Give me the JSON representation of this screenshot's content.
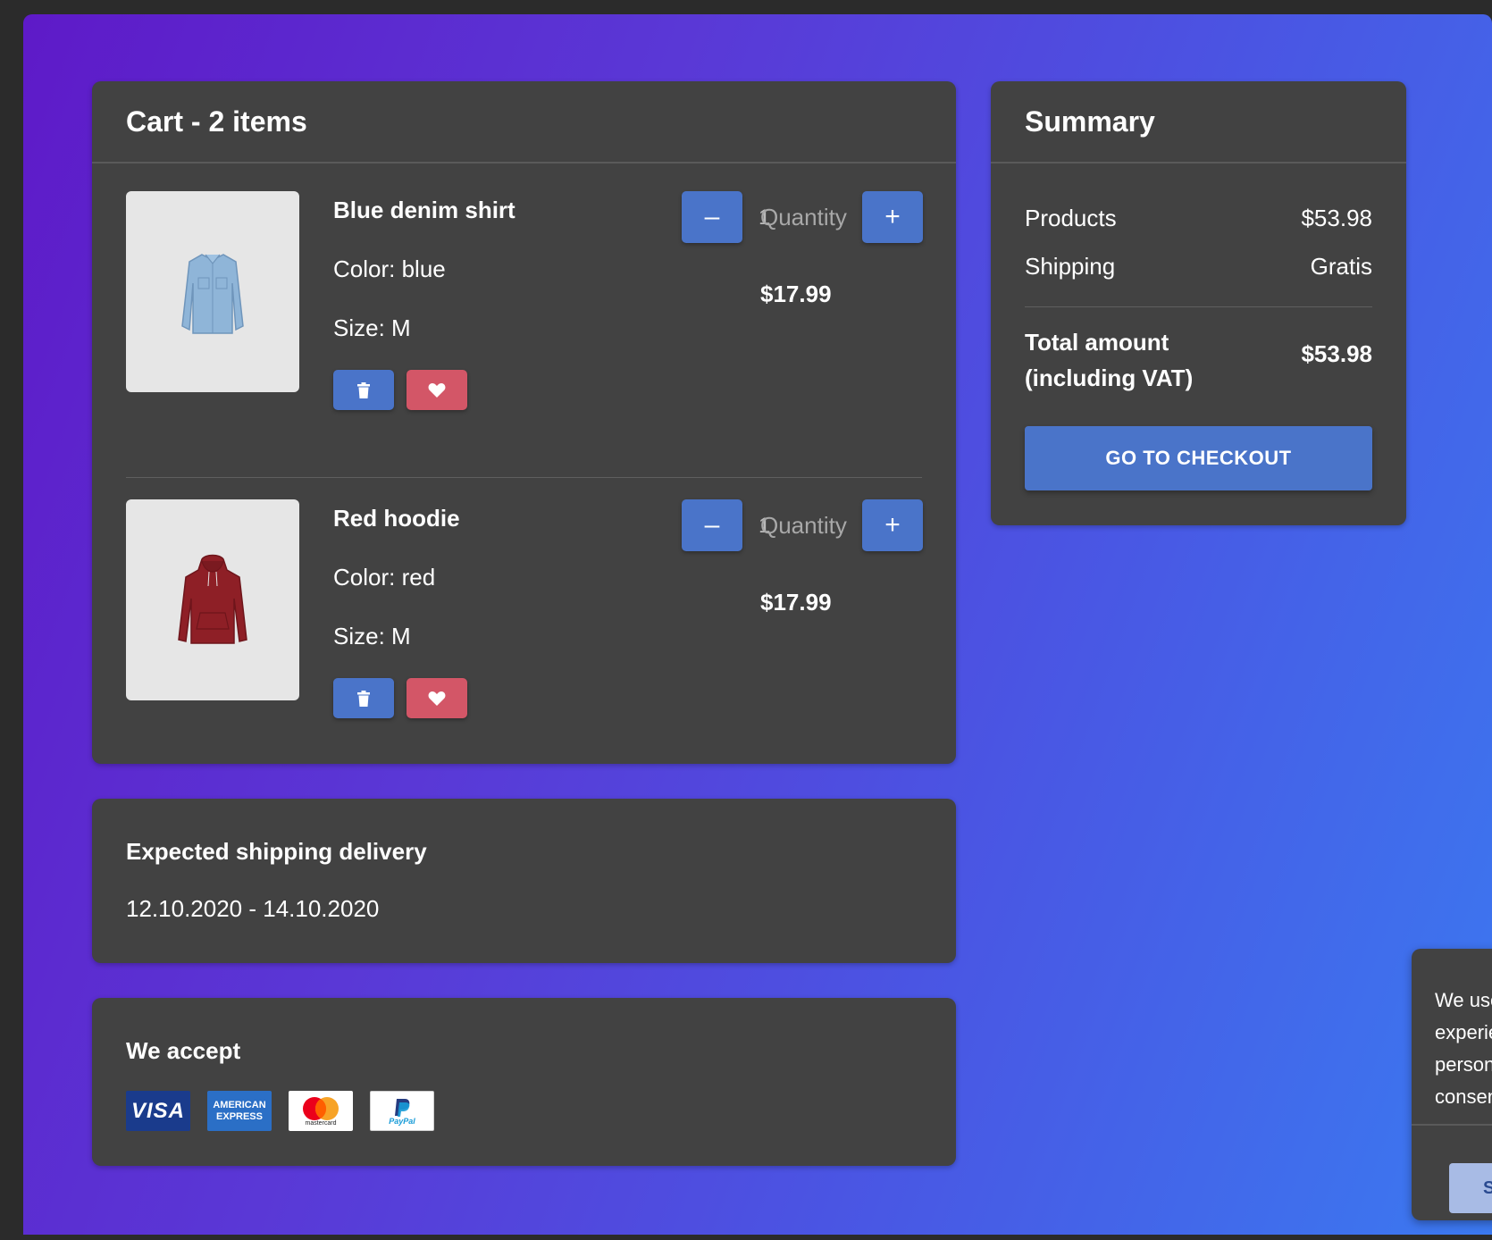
{
  "cart": {
    "title": "Cart - 2 items",
    "items": [
      {
        "name": "Blue denim shirt",
        "color": "Color: blue",
        "size": "Size: M",
        "quantity_value": "1",
        "quantity_placeholder": "Quantity",
        "price": "$17.99",
        "thumb_color": "#8fb5d8"
      },
      {
        "name": "Red hoodie",
        "color": "Color: red",
        "size": "Size: M",
        "quantity_value": "1",
        "quantity_placeholder": "Quantity",
        "price": "$17.99",
        "thumb_color": "#8e1f26"
      }
    ],
    "buttons": {
      "minus": "–",
      "plus": "+",
      "remove_icon": "trash-icon",
      "favorite_icon": "heart-icon"
    }
  },
  "shipping": {
    "title": "Expected shipping delivery",
    "dates": "12.10.2020 - 14.10.2020"
  },
  "accept": {
    "title": "We accept",
    "methods": [
      {
        "name": "VISA",
        "icon": "visa-logo"
      },
      {
        "name": "AMERICAN EXPRESS",
        "icon": "amex-logo"
      },
      {
        "name": "mastercard",
        "icon": "mastercard-logo"
      },
      {
        "name": "PayPal",
        "icon": "paypal-logo"
      }
    ]
  },
  "summary": {
    "title": "Summary",
    "products_label": "Products",
    "products_value": "$53.98",
    "shipping_label": "Shipping",
    "shipping_value": "Gratis",
    "total_label_line1": "Total amount",
    "total_label_line2": "(including VAT)",
    "total_value": "$53.98",
    "checkout_label": "GO TO CHECKOUT"
  },
  "cookie": {
    "lines": [
      "We use",
      "experie",
      "person",
      "consen"
    ],
    "button_label": "S"
  },
  "colors": {
    "primary": "#4a74c9",
    "danger": "#d35667",
    "card": "#424242",
    "gradient_start": "#5e1ac8",
    "gradient_end": "#3b79f0"
  }
}
